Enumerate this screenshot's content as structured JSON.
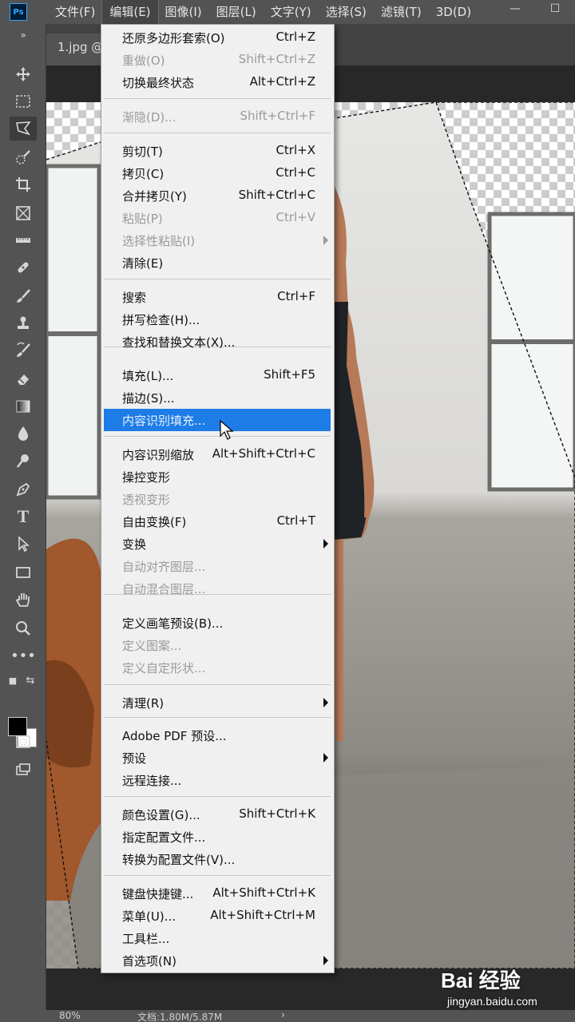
{
  "menubar": {
    "logo": "Ps",
    "items": [
      "文件(F)",
      "编辑(E)",
      "图像(I)",
      "图层(L)",
      "文字(Y)",
      "选择(S)",
      "滤镜(T)",
      "3D(D)"
    ],
    "minimize": "—",
    "maximize": "☐"
  },
  "document": {
    "tab_label": "1.jpg @"
  },
  "toolbar": {
    "tools": [
      "move-tool",
      "marquee-tool",
      "polygonal-lasso-tool",
      "quick-selection-tool",
      "crop-tool",
      "frame-tool",
      "ruler-tool",
      "healing-brush-tool",
      "brush-tool",
      "clone-stamp-tool",
      "history-brush-tool",
      "eraser-tool",
      "gradient-tool",
      "blur-tool",
      "dodge-tool",
      "pen-tool",
      "type-tool",
      "path-selection-tool",
      "rectangle-tool",
      "hand-tool",
      "zoom-tool",
      "more-tools"
    ],
    "foreground_color": "#000000",
    "background_color": "#ffffff"
  },
  "edit_menu": {
    "items": [
      {
        "label": "还原多边形套索(O)",
        "shortcut": "Ctrl+Z"
      },
      {
        "label": "重做(O)",
        "shortcut": "Shift+Ctrl+Z",
        "disabled": true
      },
      {
        "label": "切换最终状态",
        "shortcut": "Alt+Ctrl+Z"
      },
      {
        "label": "渐隐(D)...",
        "shortcut": "Shift+Ctrl+F",
        "disabled": true
      },
      {
        "label": "剪切(T)",
        "shortcut": "Ctrl+X"
      },
      {
        "label": "拷贝(C)",
        "shortcut": "Ctrl+C"
      },
      {
        "label": "合并拷贝(Y)",
        "shortcut": "Shift+Ctrl+C"
      },
      {
        "label": "粘贴(P)",
        "shortcut": "Ctrl+V",
        "disabled": true
      },
      {
        "label": "选择性粘贴(I)",
        "shortcut": "",
        "disabled": true,
        "submenu": true
      },
      {
        "label": "清除(E)",
        "shortcut": ""
      },
      {
        "label": "搜索",
        "shortcut": "Ctrl+F"
      },
      {
        "label": "拼写检查(H)...",
        "shortcut": ""
      },
      {
        "label": "查找和替换文本(X)...",
        "shortcut": ""
      },
      {
        "label": "填充(L)...",
        "shortcut": "Shift+F5"
      },
      {
        "label": "描边(S)...",
        "shortcut": ""
      },
      {
        "label": "内容识别填充...",
        "shortcut": "",
        "highlighted": true
      },
      {
        "label": "内容识别缩放",
        "shortcut": "Alt+Shift+Ctrl+C"
      },
      {
        "label": "操控变形",
        "shortcut": ""
      },
      {
        "label": "透视变形",
        "shortcut": "",
        "disabled": true
      },
      {
        "label": "自由变换(F)",
        "shortcut": "Ctrl+T"
      },
      {
        "label": "变换",
        "shortcut": "",
        "submenu": true
      },
      {
        "label": "自动对齐图层...",
        "shortcut": "",
        "disabled": true
      },
      {
        "label": "自动混合图层...",
        "shortcut": "",
        "disabled": true
      },
      {
        "label": "定义画笔预设(B)...",
        "shortcut": ""
      },
      {
        "label": "定义图案...",
        "shortcut": "",
        "disabled": true
      },
      {
        "label": "定义自定形状...",
        "shortcut": "",
        "disabled": true
      },
      {
        "label": "清理(R)",
        "shortcut": "",
        "submenu": true
      },
      {
        "label": "Adobe PDF 预设...",
        "shortcut": ""
      },
      {
        "label": "预设",
        "shortcut": "",
        "submenu": true
      },
      {
        "label": "远程连接...",
        "shortcut": ""
      },
      {
        "label": "颜色设置(G)...",
        "shortcut": "Shift+Ctrl+K"
      },
      {
        "label": "指定配置文件...",
        "shortcut": ""
      },
      {
        "label": "转换为配置文件(V)...",
        "shortcut": ""
      },
      {
        "label": "键盘快捷键...",
        "shortcut": "Alt+Shift+Ctrl+K"
      },
      {
        "label": "菜单(U)...",
        "shortcut": "Alt+Shift+Ctrl+M"
      },
      {
        "label": "工具栏...",
        "shortcut": ""
      },
      {
        "label": "首选项(N)",
        "shortcut": "",
        "submenu": true
      }
    ]
  },
  "statusbar": {
    "zoom": "80%",
    "doc_info": "文档:1.80M/5.87M",
    "arrow": "›"
  },
  "watermark": {
    "logo": "Bai 经验",
    "url": "jingyan.baidu.com"
  }
}
